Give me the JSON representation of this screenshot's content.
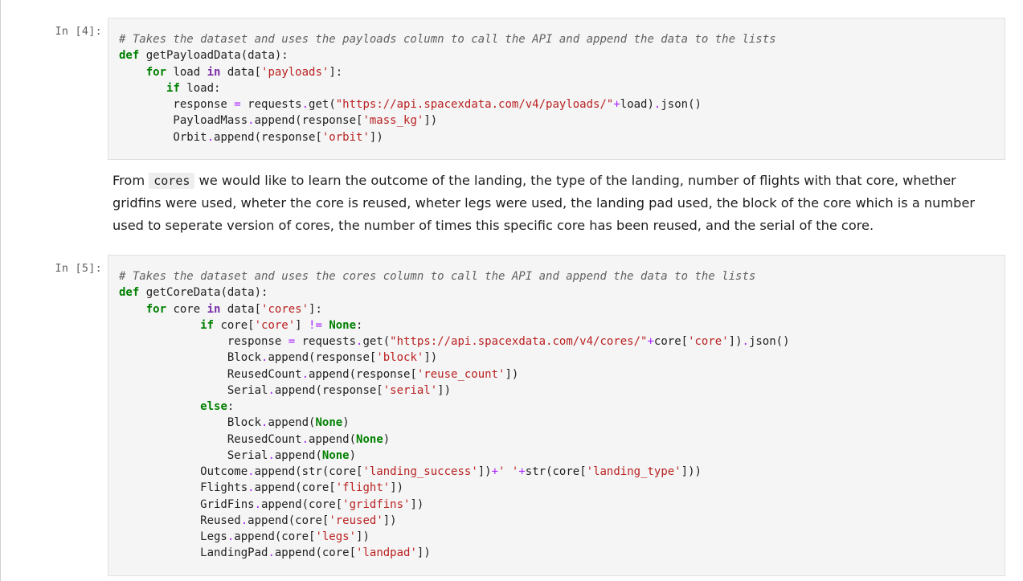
{
  "cells": [
    {
      "prompt": "In [4]:",
      "lines": [
        [
          {
            "t": "c",
            "v": "# Takes the dataset and uses the payloads column to call the API and append the data to the lists"
          }
        ],
        [
          {
            "t": "k",
            "v": "def"
          },
          {
            "t": "n",
            "v": " getPayloadData(data):"
          }
        ],
        [
          {
            "t": "n",
            "v": "    "
          },
          {
            "t": "k",
            "v": "for"
          },
          {
            "t": "n",
            "v": " load "
          },
          {
            "t": "kw",
            "v": "in"
          },
          {
            "t": "n",
            "v": " data["
          },
          {
            "t": "s",
            "v": "'payloads'"
          },
          {
            "t": "n",
            "v": "]:"
          }
        ],
        [
          {
            "t": "n",
            "v": "       "
          },
          {
            "t": "k",
            "v": "if"
          },
          {
            "t": "n",
            "v": " load:"
          }
        ],
        [
          {
            "t": "n",
            "v": "        response "
          },
          {
            "t": "o",
            "v": "="
          },
          {
            "t": "n",
            "v": " requests"
          },
          {
            "t": "o",
            "v": "."
          },
          {
            "t": "n",
            "v": "get("
          },
          {
            "t": "s",
            "v": "\"https://api.spacexdata.com/v4/payloads/\""
          },
          {
            "t": "o",
            "v": "+"
          },
          {
            "t": "n",
            "v": "load)"
          },
          {
            "t": "o",
            "v": "."
          },
          {
            "t": "n",
            "v": "json()"
          }
        ],
        [
          {
            "t": "n",
            "v": "        PayloadMass"
          },
          {
            "t": "o",
            "v": "."
          },
          {
            "t": "n",
            "v": "append(response["
          },
          {
            "t": "s",
            "v": "'mass_kg'"
          },
          {
            "t": "n",
            "v": "])"
          }
        ],
        [
          {
            "t": "n",
            "v": "        Orbit"
          },
          {
            "t": "o",
            "v": "."
          },
          {
            "t": "n",
            "v": "append(response["
          },
          {
            "t": "s",
            "v": "'orbit'"
          },
          {
            "t": "n",
            "v": "])"
          }
        ]
      ]
    },
    {
      "prompt": "In [5]:",
      "lines": [
        [
          {
            "t": "c",
            "v": "# Takes the dataset and uses the cores column to call the API and append the data to the lists"
          }
        ],
        [
          {
            "t": "k",
            "v": "def"
          },
          {
            "t": "n",
            "v": " getCoreData(data):"
          }
        ],
        [
          {
            "t": "n",
            "v": "    "
          },
          {
            "t": "k",
            "v": "for"
          },
          {
            "t": "n",
            "v": " core "
          },
          {
            "t": "kw",
            "v": "in"
          },
          {
            "t": "n",
            "v": " data["
          },
          {
            "t": "s",
            "v": "'cores'"
          },
          {
            "t": "n",
            "v": "]:"
          }
        ],
        [
          {
            "t": "n",
            "v": "            "
          },
          {
            "t": "k",
            "v": "if"
          },
          {
            "t": "n",
            "v": " core["
          },
          {
            "t": "s",
            "v": "'core'"
          },
          {
            "t": "n",
            "v": "] "
          },
          {
            "t": "o",
            "v": "!="
          },
          {
            "t": "n",
            "v": " "
          },
          {
            "t": "k",
            "v": "None"
          },
          {
            "t": "n",
            "v": ":"
          }
        ],
        [
          {
            "t": "n",
            "v": "                response "
          },
          {
            "t": "o",
            "v": "="
          },
          {
            "t": "n",
            "v": " requests"
          },
          {
            "t": "o",
            "v": "."
          },
          {
            "t": "n",
            "v": "get("
          },
          {
            "t": "s",
            "v": "\"https://api.spacexdata.com/v4/cores/\""
          },
          {
            "t": "o",
            "v": "+"
          },
          {
            "t": "n",
            "v": "core["
          },
          {
            "t": "s",
            "v": "'core'"
          },
          {
            "t": "n",
            "v": "])"
          },
          {
            "t": "o",
            "v": "."
          },
          {
            "t": "n",
            "v": "json()"
          }
        ],
        [
          {
            "t": "n",
            "v": "                Block"
          },
          {
            "t": "o",
            "v": "."
          },
          {
            "t": "n",
            "v": "append(response["
          },
          {
            "t": "s",
            "v": "'block'"
          },
          {
            "t": "n",
            "v": "])"
          }
        ],
        [
          {
            "t": "n",
            "v": "                ReusedCount"
          },
          {
            "t": "o",
            "v": "."
          },
          {
            "t": "n",
            "v": "append(response["
          },
          {
            "t": "s",
            "v": "'reuse_count'"
          },
          {
            "t": "n",
            "v": "])"
          }
        ],
        [
          {
            "t": "n",
            "v": "                Serial"
          },
          {
            "t": "o",
            "v": "."
          },
          {
            "t": "n",
            "v": "append(response["
          },
          {
            "t": "s",
            "v": "'serial'"
          },
          {
            "t": "n",
            "v": "])"
          }
        ],
        [
          {
            "t": "n",
            "v": "            "
          },
          {
            "t": "k",
            "v": "else"
          },
          {
            "t": "n",
            "v": ":"
          }
        ],
        [
          {
            "t": "n",
            "v": "                Block"
          },
          {
            "t": "o",
            "v": "."
          },
          {
            "t": "n",
            "v": "append("
          },
          {
            "t": "k",
            "v": "None"
          },
          {
            "t": "n",
            "v": ")"
          }
        ],
        [
          {
            "t": "n",
            "v": "                ReusedCount"
          },
          {
            "t": "o",
            "v": "."
          },
          {
            "t": "n",
            "v": "append("
          },
          {
            "t": "k",
            "v": "None"
          },
          {
            "t": "n",
            "v": ")"
          }
        ],
        [
          {
            "t": "n",
            "v": "                Serial"
          },
          {
            "t": "o",
            "v": "."
          },
          {
            "t": "n",
            "v": "append("
          },
          {
            "t": "k",
            "v": "None"
          },
          {
            "t": "n",
            "v": ")"
          }
        ],
        [
          {
            "t": "n",
            "v": "            Outcome"
          },
          {
            "t": "o",
            "v": "."
          },
          {
            "t": "n",
            "v": "append(str(core["
          },
          {
            "t": "s",
            "v": "'landing_success'"
          },
          {
            "t": "n",
            "v": "])"
          },
          {
            "t": "o",
            "v": "+"
          },
          {
            "t": "s",
            "v": "' '"
          },
          {
            "t": "o",
            "v": "+"
          },
          {
            "t": "n",
            "v": "str(core["
          },
          {
            "t": "s",
            "v": "'landing_type'"
          },
          {
            "t": "n",
            "v": "]))"
          }
        ],
        [
          {
            "t": "n",
            "v": "            Flights"
          },
          {
            "t": "o",
            "v": "."
          },
          {
            "t": "n",
            "v": "append(core["
          },
          {
            "t": "s",
            "v": "'flight'"
          },
          {
            "t": "n",
            "v": "])"
          }
        ],
        [
          {
            "t": "n",
            "v": "            GridFins"
          },
          {
            "t": "o",
            "v": "."
          },
          {
            "t": "n",
            "v": "append(core["
          },
          {
            "t": "s",
            "v": "'gridfins'"
          },
          {
            "t": "n",
            "v": "])"
          }
        ],
        [
          {
            "t": "n",
            "v": "            Reused"
          },
          {
            "t": "o",
            "v": "."
          },
          {
            "t": "n",
            "v": "append(core["
          },
          {
            "t": "s",
            "v": "'reused'"
          },
          {
            "t": "n",
            "v": "])"
          }
        ],
        [
          {
            "t": "n",
            "v": "            Legs"
          },
          {
            "t": "o",
            "v": "."
          },
          {
            "t": "n",
            "v": "append(core["
          },
          {
            "t": "s",
            "v": "'legs'"
          },
          {
            "t": "n",
            "v": "])"
          }
        ],
        [
          {
            "t": "n",
            "v": "            LandingPad"
          },
          {
            "t": "o",
            "v": "."
          },
          {
            "t": "n",
            "v": "append(core["
          },
          {
            "t": "s",
            "v": "'landpad'"
          },
          {
            "t": "n",
            "v": "])"
          }
        ]
      ]
    }
  ],
  "markdown": {
    "prefix": "From ",
    "code": "cores",
    "suffix": " we would like to learn the outcome of the landing, the type of the landing, number of flights with that core, whether gridfins were used, wheter the core is reused, wheter legs were used, the landing pad used, the block of the core which is a number used to seperate version of cores, the number of times this specific core has been reused, and the serial of the core."
  },
  "colors": {
    "code_background": "#f5f5f5",
    "keyword": "#008000",
    "operator": "#aa22ff",
    "string": "#ba2121",
    "comment": "#616161"
  }
}
